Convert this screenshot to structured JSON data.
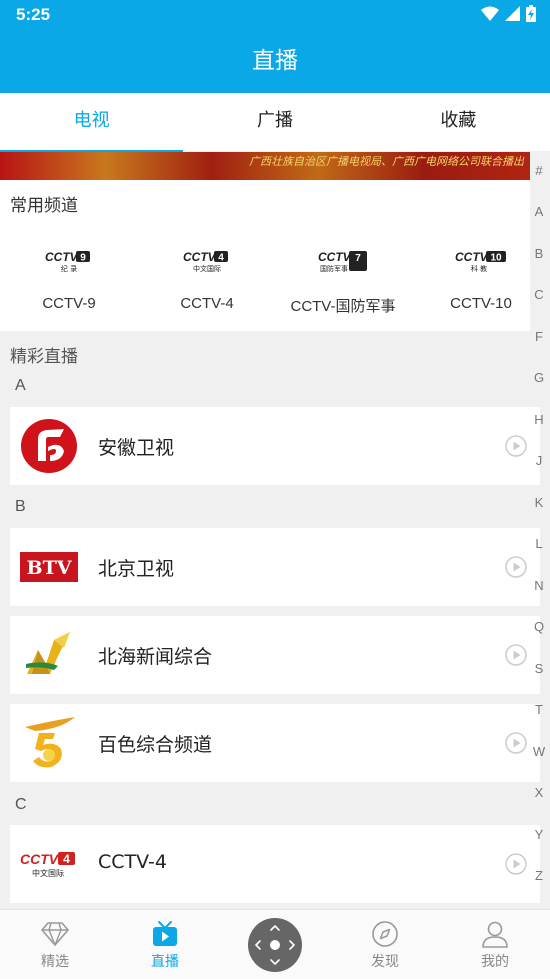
{
  "status": {
    "time": "5:25"
  },
  "appbar": {
    "title": "直播"
  },
  "tabs": [
    {
      "label": "电视"
    },
    {
      "label": "广播"
    },
    {
      "label": "收藏"
    }
  ],
  "banner": {
    "text": "广西壮族自治区广播电视局、广西广电网络公司联合播出"
  },
  "common": {
    "title": "常用频道",
    "channels": [
      {
        "name": "CCTV-9",
        "logo_num": "9",
        "logo_sub": "纪 录"
      },
      {
        "name": "CCTV-4",
        "logo_num": "4",
        "logo_sub": "中文国际"
      },
      {
        "name": "CCTV-国防军事",
        "logo_num": "7",
        "logo_sub": "国防军事"
      },
      {
        "name": "CCTV-10",
        "logo_num": "10",
        "logo_sub": "科 教"
      }
    ]
  },
  "live": {
    "title": "精彩直播",
    "groups": [
      {
        "letter": "A",
        "items": [
          {
            "name": "安徽卫视"
          }
        ]
      },
      {
        "letter": "B",
        "items": [
          {
            "name": "北京卫视",
            "logo_text": "BTV"
          },
          {
            "name": "北海新闻综合"
          },
          {
            "name": "百色综合频道"
          }
        ]
      },
      {
        "letter": "C",
        "items": [
          {
            "name": "CCTV-4",
            "logo_num": "4",
            "logo_sub": "中文国际"
          }
        ]
      }
    ]
  },
  "index_letters": [
    "#",
    "A",
    "B",
    "C",
    "F",
    "G",
    "H",
    "J",
    "K",
    "L",
    "N",
    "Q",
    "S",
    "T",
    "W",
    "X",
    "Y",
    "Z"
  ],
  "bottom_nav": [
    {
      "label": "精选",
      "icon": "diamond-icon"
    },
    {
      "label": "直播",
      "icon": "tv-play-icon"
    },
    {
      "label": "",
      "icon": "remote-control-icon"
    },
    {
      "label": "发现",
      "icon": "compass-icon"
    },
    {
      "label": "我的",
      "icon": "user-icon"
    }
  ],
  "colors": {
    "accent": "#0ba8e8",
    "cctv_red": "#d2221f",
    "ahtv_red": "#d0121b",
    "btv_red": "#c8141e"
  }
}
